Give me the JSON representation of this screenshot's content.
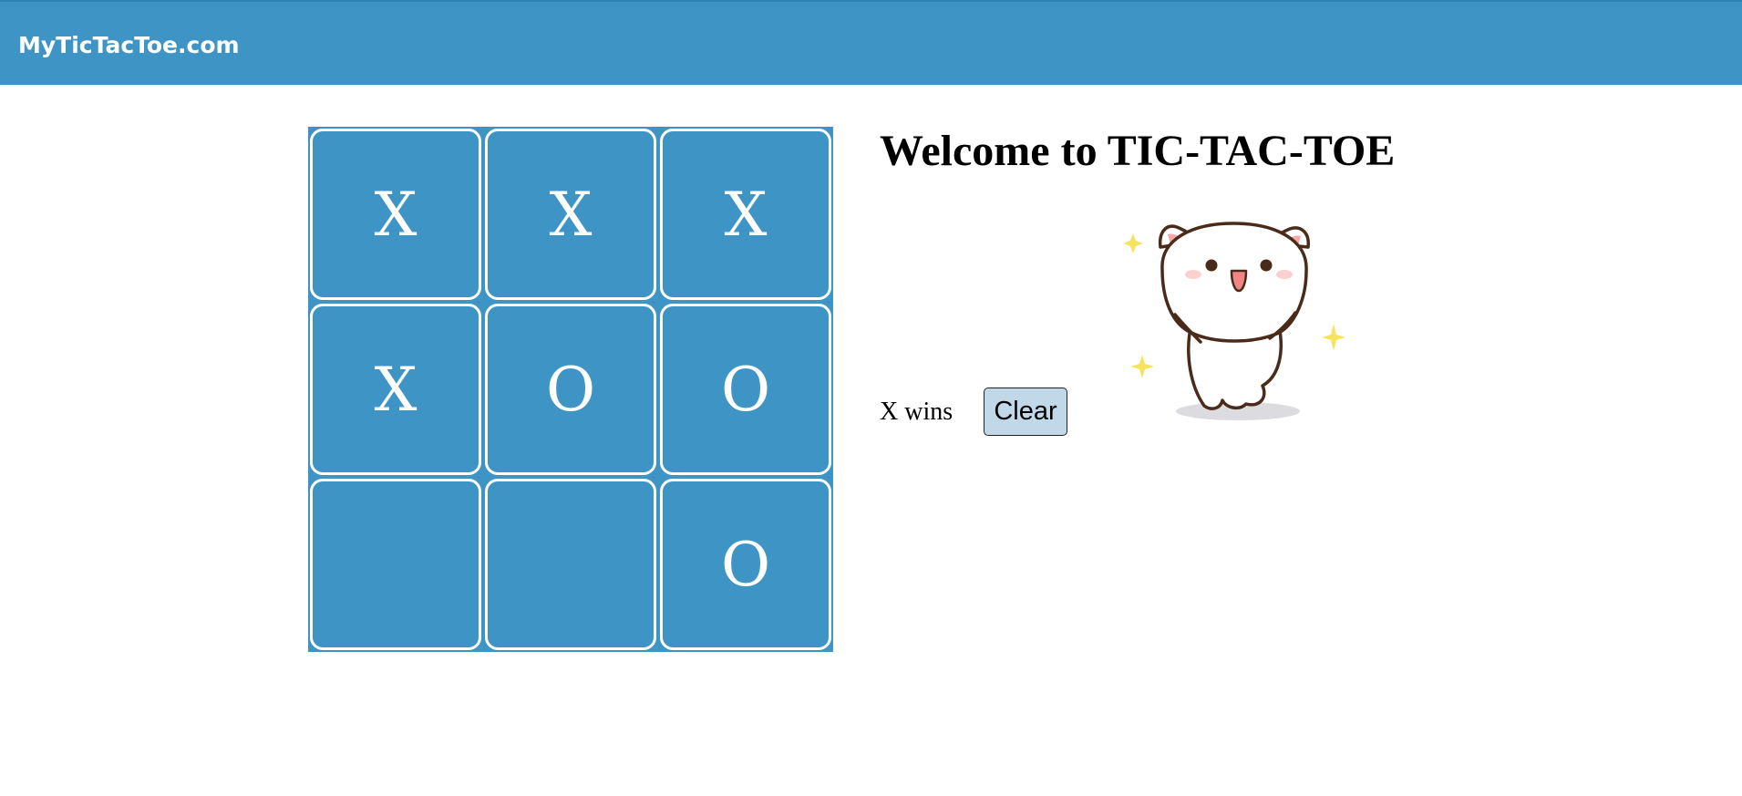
{
  "header": {
    "brand": "MyTicTacToe.com"
  },
  "game": {
    "title": "Welcome to TIC-TAC-TOE",
    "status": "X wins",
    "clear_label": "Clear",
    "board": [
      "X",
      "X",
      "X",
      "X",
      "O",
      "O",
      "",
      "",
      "O"
    ]
  },
  "image": {
    "icon": "happy-cat-sticker"
  },
  "colors": {
    "accent": "#3e95c5",
    "button_bg": "#c0d8e8"
  }
}
